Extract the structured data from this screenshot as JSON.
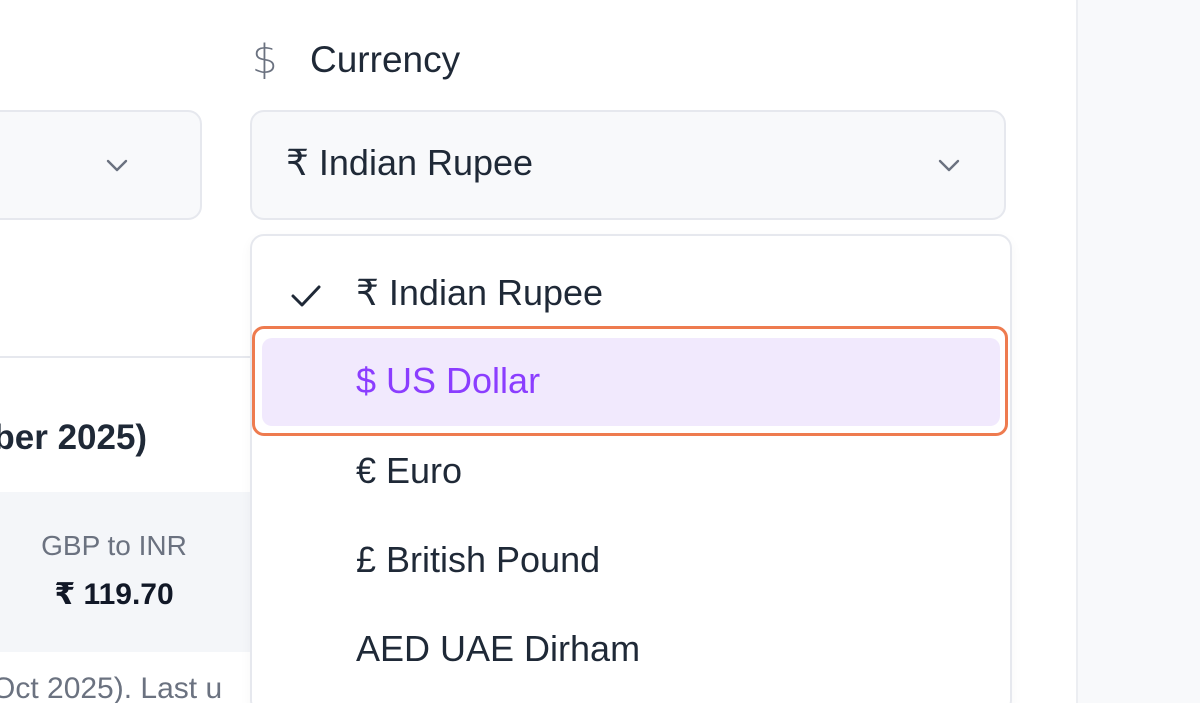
{
  "left_panel": {
    "section_title": "ober 2025)",
    "rate": {
      "label": "GBP to INR",
      "value": "₹ 119.70"
    },
    "footnote": "Oct 2025). Last u"
  },
  "currency_field": {
    "label": "Currency",
    "icon": "dollar-icon",
    "selected_value": "₹ Indian Rupee",
    "options": [
      {
        "label": "₹ Indian Rupee",
        "selected": true
      },
      {
        "label": "$ US Dollar",
        "highlighted": true
      },
      {
        "label": "€ Euro"
      },
      {
        "label": "£ British Pound"
      },
      {
        "label": "AED UAE Dirham"
      }
    ]
  },
  "colors": {
    "accent": "#8b3dff",
    "highlight_bg": "#f1e9fd",
    "focus_ring": "#ee7b4f"
  }
}
